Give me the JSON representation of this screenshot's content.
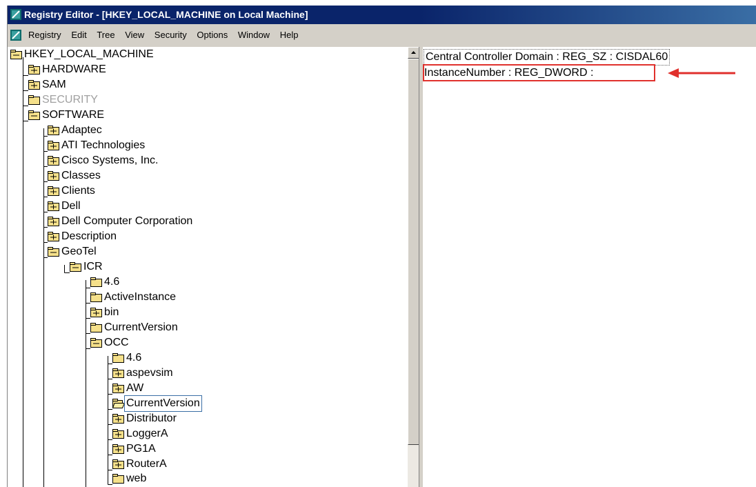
{
  "window": {
    "title": "Registry Editor - [HKEY_LOCAL_MACHINE on Local Machine]",
    "app_icon": "registry-editor-icon"
  },
  "menubar": {
    "items": [
      "Registry",
      "Edit",
      "Tree",
      "View",
      "Security",
      "Options",
      "Window",
      "Help"
    ]
  },
  "tree": {
    "root": "HKEY_LOCAL_MACHINE",
    "hardware": "HARDWARE",
    "sam": "SAM",
    "security": "SECURITY",
    "software": "SOFTWARE",
    "adaptec": "Adaptec",
    "ati": "ATI Technologies",
    "cisco": "Cisco Systems, Inc.",
    "classes": "Classes",
    "clients": "Clients",
    "dell": "Dell",
    "dell_cc": "Dell Computer Corporation",
    "description": "Description",
    "geotel": "GeoTel",
    "icr": "ICR",
    "icr_46": "4.6",
    "activeinstance": "ActiveInstance",
    "bin": "bin",
    "icr_currentversion": "CurrentVersion",
    "occ": "OCC",
    "occ_46": "4.6",
    "aspevsim": "aspevsim",
    "aw": "AW",
    "occ_currentversion": "CurrentVersion",
    "distributor": "Distributor",
    "loggera": "LoggerA",
    "pg1a": "PG1A",
    "routera": "RouterA",
    "web": "web"
  },
  "values": {
    "row1": "Central Controller Domain : REG_SZ : CISDAL60",
    "row2": "InstanceNumber : REG_DWORD :"
  },
  "colors": {
    "title_bar": "#0a246a",
    "highlight_box": "#e0302c",
    "arrow": "#e0302c",
    "folder_fill": "#f5e08a"
  }
}
